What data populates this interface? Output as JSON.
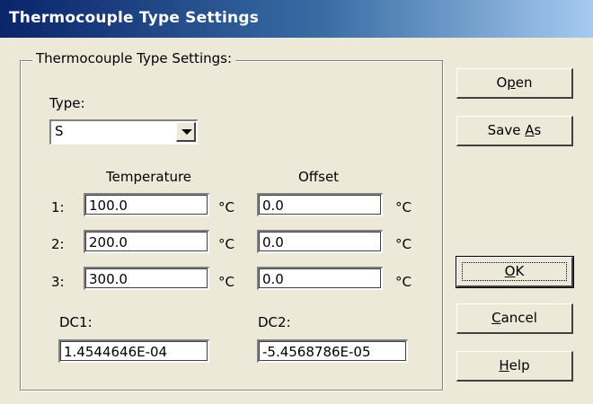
{
  "window": {
    "title": "Thermocouple Type Settings"
  },
  "group": {
    "legend": "Thermocouple Type Settings:"
  },
  "type": {
    "label": "Type:",
    "value": "S"
  },
  "headers": {
    "temperature": "Temperature",
    "offset": "Offset"
  },
  "rows": [
    {
      "index": "1:",
      "temperature": "100.0",
      "temp_unit": "°C",
      "offset": "0.0",
      "offset_unit": "°C"
    },
    {
      "index": "2:",
      "temperature": "200.0",
      "temp_unit": "°C",
      "offset": "0.0",
      "offset_unit": "°C"
    },
    {
      "index": "3:",
      "temperature": "300.0",
      "temp_unit": "°C",
      "offset": "0.0",
      "offset_unit": "°C"
    }
  ],
  "dc1": {
    "label": "DC1:",
    "value": "1.4544646E-04"
  },
  "dc2": {
    "label": "DC2:",
    "value": "-5.4568786E-05"
  },
  "buttons": {
    "open": {
      "pre": "O",
      "accel": "p",
      "post": "en"
    },
    "save_as": {
      "pre": "Save ",
      "accel": "A",
      "post": "s"
    },
    "ok": {
      "pre": "",
      "accel": "O",
      "post": "K"
    },
    "cancel": {
      "pre": "",
      "accel": "C",
      "post": "ancel"
    },
    "help": {
      "pre": "",
      "accel": "H",
      "post": "elp"
    }
  },
  "colors": {
    "title_start": "#0a246a",
    "title_end": "#a6caf0",
    "face": "#ece9d8"
  }
}
